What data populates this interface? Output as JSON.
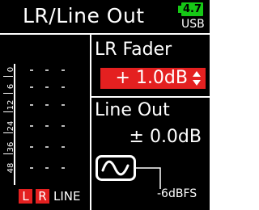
{
  "header": {
    "title": "LR/Line Out",
    "battery_level": "4.7",
    "battery_color": "#16c716",
    "connection": "USB"
  },
  "meter": {
    "scale_labels": [
      "0",
      "6",
      "12",
      "24",
      "36",
      "48"
    ],
    "channels": [
      {
        "label": "L",
        "color": "#e42020"
      },
      {
        "label": "R",
        "color": "#e42020"
      }
    ],
    "line_label": "LINE"
  },
  "lr_fader": {
    "label": "LR Fader",
    "value": "+ 1.0dB",
    "highlight_color": "#e42020",
    "icon": "up-down-arrows-icon"
  },
  "line_out": {
    "label": "Line Out",
    "value": "± 0.0dB",
    "icon": "sine-wave-icon",
    "reference_level": "-6dBFS"
  }
}
